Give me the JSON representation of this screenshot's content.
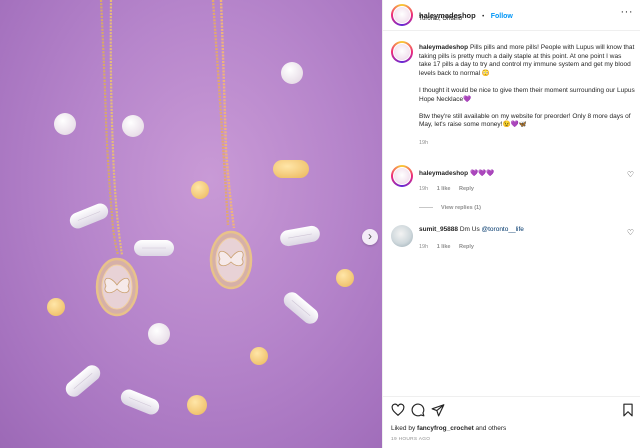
{
  "post": {
    "author": "haleymadeshop",
    "location": "Toronto, Ontario",
    "follow_label": "Follow",
    "separator": "•",
    "more_label": "···",
    "caption_paragraphs": [
      "Pills pills and more pills! People with Lupus will know that taking pills is pretty much a daily staple at this point. At one point I was take 17 pills a day to try and control my immune system and get my blood levels back to normal 😳",
      "I thought it would be nice to give them their moment surrounding our Lupus Hope Necklace💜",
      "Btw they're still available on my website for preorder! Only 8 more days of May, let's raise some money!😉💜🦋"
    ],
    "caption_time": "19h"
  },
  "comments": [
    {
      "user": "haleymadeshop",
      "text": "💜💜💜",
      "time": "19h",
      "likes": "1 like",
      "reply": "Reply",
      "view_replies": "View replies (1)"
    },
    {
      "user": "sumit_95888",
      "text_prefix": "Dm Us ",
      "mention": "@toronto__life",
      "time": "19h",
      "likes": "1 like",
      "reply": "Reply"
    }
  ],
  "footer": {
    "liked_by_prefix": "Liked by ",
    "liked_by_user": "fancyfrog_crochet",
    "liked_by_suffix": " and others",
    "timestamp": "19 HOURS AGO"
  },
  "colors": {
    "background": "#b685cb",
    "link_blue": "#0095f6",
    "text": "#262626",
    "muted": "#8e8e8e"
  },
  "icons": [
    "heart-icon",
    "comment-icon",
    "share-icon",
    "bookmark-icon",
    "next-arrow-icon",
    "more-options-icon"
  ]
}
